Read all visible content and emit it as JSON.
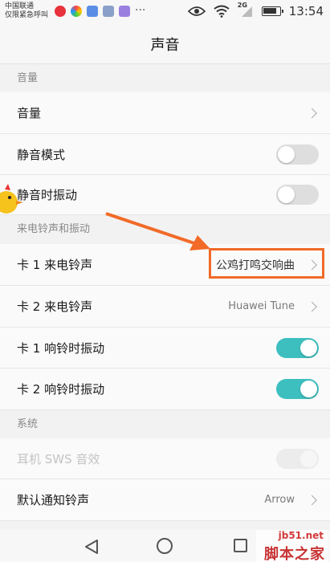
{
  "status_bar": {
    "carrier_line1": "中国联通",
    "carrier_line2": "仅限紧急呼叫",
    "more_dots": "···",
    "network": "2G",
    "time": "13:54",
    "battery_level": 0.85
  },
  "header": {
    "title": "声音"
  },
  "sections": {
    "volume": "音量",
    "ringtone": "来电铃声和振动",
    "system": "系统"
  },
  "rows": {
    "volume": {
      "label": "音量"
    },
    "silent_mode": {
      "label": "静音模式",
      "on": false
    },
    "vibrate_silent": {
      "label": "静音时振动",
      "on": false
    },
    "card1_ringtone": {
      "label": "卡 1 来电铃声",
      "value": "公鸡打鸣交响曲"
    },
    "card2_ringtone": {
      "label": "卡 2 来电铃声",
      "value": "Huawei Tune"
    },
    "card1_vibrate": {
      "label": "卡 1 响铃时振动",
      "on": true
    },
    "card2_vibrate": {
      "label": "卡 2 响铃时振动",
      "on": true
    },
    "earphone_sws": {
      "label": "耳机 SWS 音效",
      "on": true,
      "disabled": true
    },
    "default_notification": {
      "label": "默认通知铃声",
      "value": "Arrow"
    }
  },
  "watermark": {
    "url": "jb51.net",
    "name": "脚本之家"
  },
  "colors": {
    "accent": "#3dbfbf",
    "highlight": "#f26a27"
  }
}
